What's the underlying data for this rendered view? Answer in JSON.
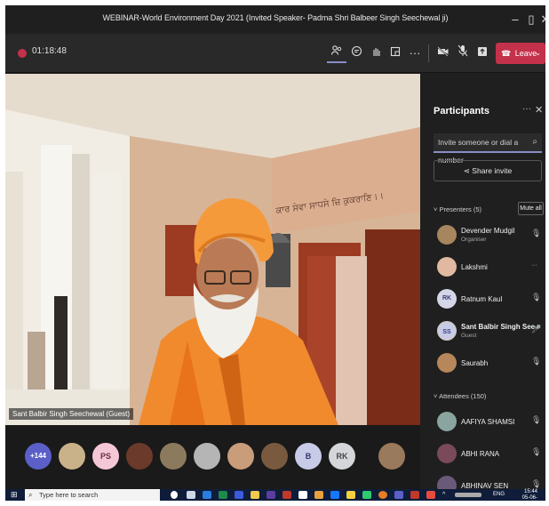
{
  "window": {
    "title": "WEBINAR-World Environment Day 2021 (Invited Speaker- Padma Shri Balbeer Singh Seechewal ji)"
  },
  "toolbar": {
    "timer": "01:18:48",
    "leave_label": "Leave",
    "icons": [
      "people-icon",
      "chat-icon",
      "raise-hand-icon",
      "rooms-icon",
      "more-icon",
      "camera-off-icon",
      "mic-off-icon",
      "share-icon"
    ]
  },
  "video": {
    "speaker_label": "Sant Balbir Singh Seechewal (Guest)",
    "wall_text": "ਕਾਰ ਸੇਵਾ ਸਾਧਸੇ ਜ਼ਿ ਕੁਕਰਾਣਿ।।"
  },
  "strip": {
    "overflow": "+144",
    "initials": [
      "PS",
      "B",
      "RK"
    ]
  },
  "panel": {
    "title": "Participants",
    "invite_placeholder": "Invite someone or dial a number",
    "share_label": "Share invite",
    "presenters_label": "Presenters (5)",
    "mute_all_label": "Mute all",
    "attendees_label": "Attendees (150)",
    "presenters": [
      {
        "name": "Devender Mudgil",
        "sub": "Organiser"
      },
      {
        "name": "Lakshmi",
        "sub": ""
      },
      {
        "name": "Ratnum Kaul",
        "sub": "",
        "initials": "RK"
      },
      {
        "name": "Sant Balbir Singh Seechewal ...",
        "sub": "Guest",
        "initials": "SS"
      },
      {
        "name": "Saurabh",
        "sub": ""
      }
    ],
    "attendees": [
      {
        "name": "AAFIYA SHAMSI"
      },
      {
        "name": "ABHI RANA"
      },
      {
        "name": "ABHINAV SEN"
      }
    ]
  },
  "taskbar": {
    "search_placeholder": "Type here to search",
    "lang": "ENG",
    "time": "15:44",
    "date": "05-06-2021"
  },
  "colors": {
    "leave": "#c4314b",
    "accent": "#8b8cc7",
    "robe": "#f08a2c"
  }
}
